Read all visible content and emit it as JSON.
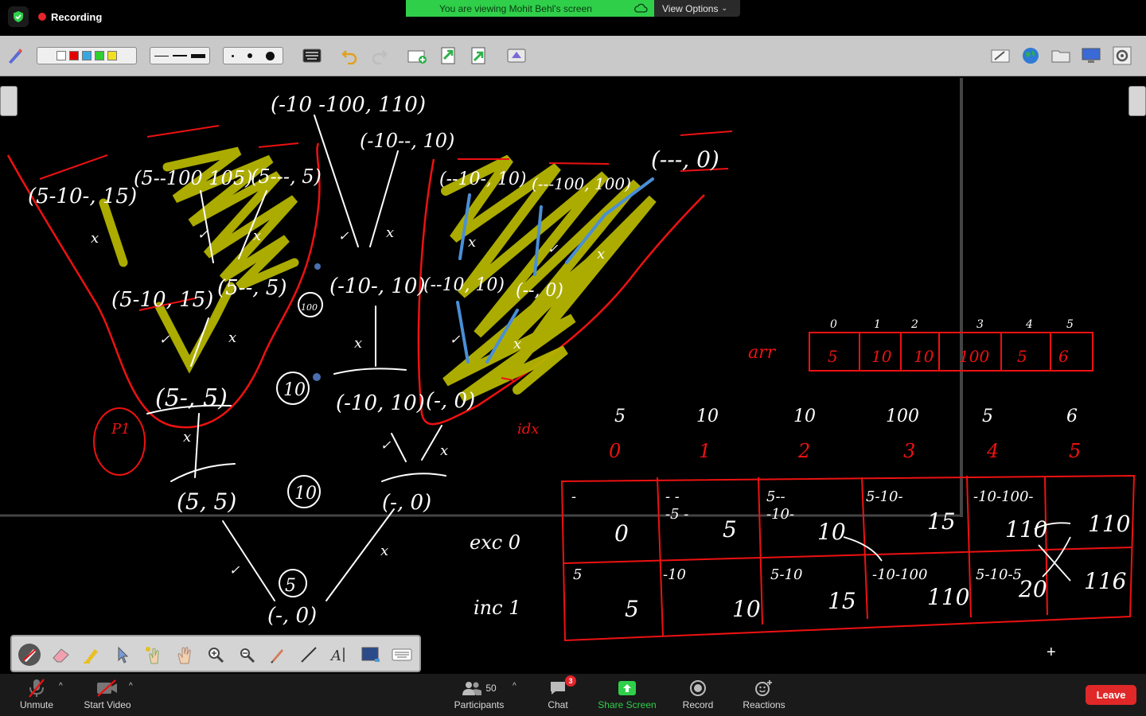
{
  "top_bar": {
    "recording_label": "Recording",
    "share_banner": "You are viewing Mohit Behl's screen",
    "view_options": "View Options"
  },
  "toolbar": {
    "colors": [
      "#ffffff",
      "#e60000",
      "#36a7e0",
      "#2fcf2f",
      "#f0e020"
    ]
  },
  "whiteboard": {
    "tree": {
      "root": "(-10 -100, 110)",
      "left_branch": "(-10--, 10)",
      "nodes": [
        "(5-10-, 15)",
        "(5--100 105)",
        "(5---, 5)",
        "(--10-, 10)",
        "(---100, 100)",
        "(---, 0)",
        "(5-10, 15)",
        "(5--, 5)",
        "(-10-, 10)",
        "(--10, 10)",
        "(--, 0)",
        "(5-, 5)",
        "(-10, 10)",
        "(-, 0)",
        "(5, 5)",
        "(-, 0)",
        "(-, 0)"
      ],
      "numbers": [
        "100",
        "10",
        "10",
        "5"
      ],
      "marks": [
        "x",
        "x",
        "x",
        "x",
        "x",
        "x",
        "x",
        "x",
        "x"
      ],
      "note": "P1"
    },
    "array": {
      "label": "arr",
      "indices": [
        "0",
        "1",
        "2",
        "3",
        "4",
        "5"
      ],
      "values": [
        "5",
        "10",
        "10",
        "100",
        "5",
        "6"
      ]
    },
    "idx_row": {
      "label": "idx",
      "values": [
        "5",
        "10",
        "10",
        "100",
        "5",
        "6"
      ],
      "indices": [
        "0",
        "1",
        "2",
        "3",
        "4",
        "5"
      ]
    },
    "dp_table": {
      "row_labels": [
        "exc  0",
        "inc  1"
      ],
      "exc_notes": [
        "-",
        "- -\n-5 -",
        "5--\n-10-",
        "5-10-",
        "-10-100-",
        ""
      ],
      "exc_values": [
        "0",
        "5",
        "10",
        "15",
        "110",
        "110"
      ],
      "inc_notes": [
        "5",
        "-10",
        "5-10",
        "-10-100",
        "5-10-5",
        ""
      ],
      "inc_values": [
        "5",
        "10",
        "15",
        "110",
        "20",
        "116"
      ]
    }
  },
  "bottom_bar": {
    "unmute": "Unmute",
    "start_video": "Start Video",
    "participants": "Participants",
    "participants_count": "50",
    "chat": "Chat",
    "chat_badge": "3",
    "share_screen": "Share Screen",
    "record": "Record",
    "reactions": "Reactions",
    "leave": "Leave"
  }
}
